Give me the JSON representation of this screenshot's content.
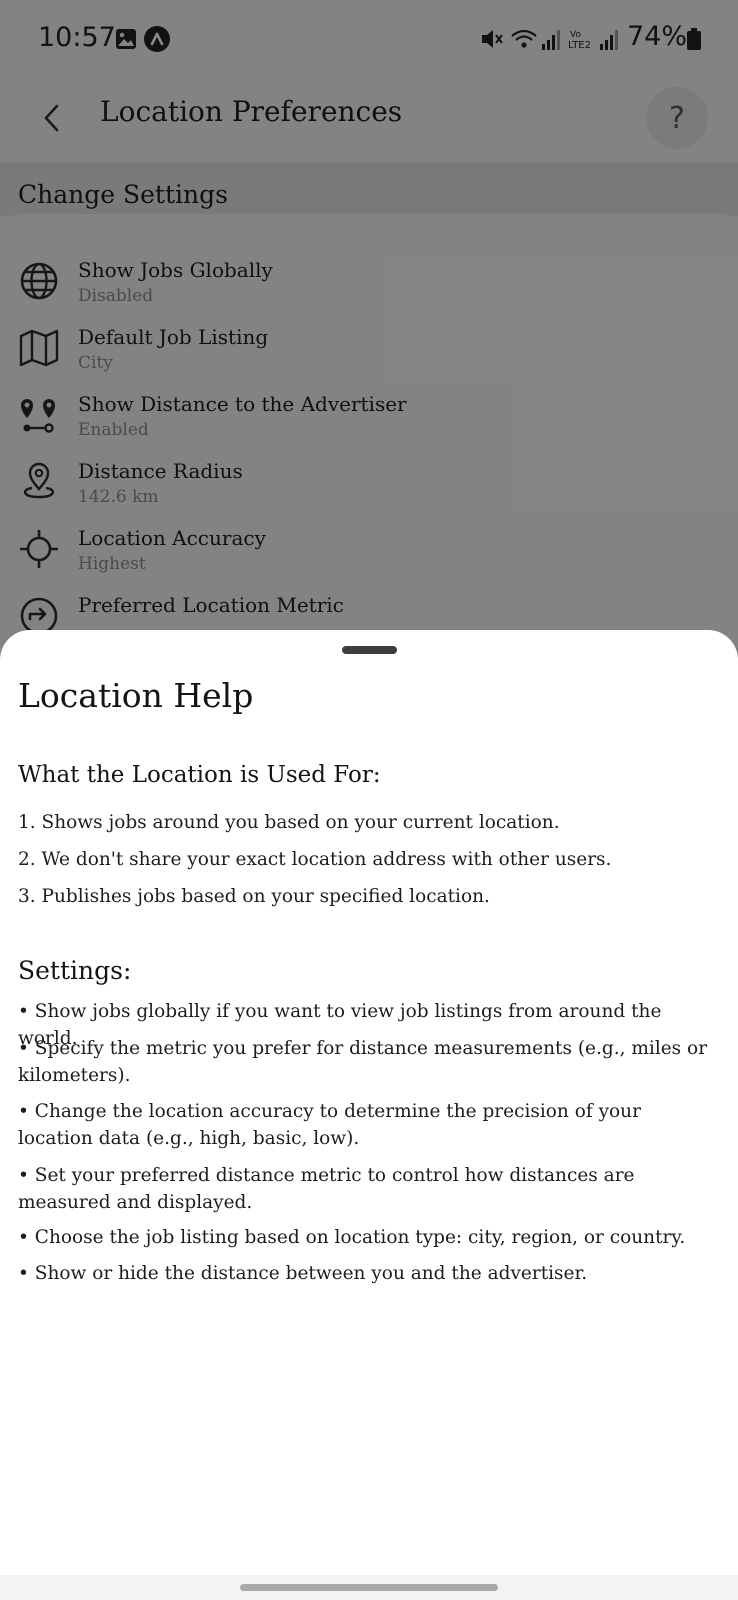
{
  "status_bar": {
    "time": "10:57",
    "battery": "74%",
    "icons": [
      "gallery-icon",
      "app-notification-icon",
      "mute-icon",
      "wifi-icon",
      "signal-icon",
      "volte-icon",
      "battery-icon"
    ]
  },
  "header": {
    "title": "Location Preferences",
    "help_label": "?"
  },
  "section": {
    "title": "Change Settings"
  },
  "settings": [
    {
      "title": "Show Jobs Globally",
      "value": "Disabled",
      "icon": "globe-icon"
    },
    {
      "title": "Default Job Listing",
      "value": "City",
      "icon": "map-icon"
    },
    {
      "title": "Show Distance to the Advertiser",
      "value": "Enabled",
      "icon": "route-icon"
    },
    {
      "title": "Distance Radius",
      "value": "142.6 km",
      "icon": "location-pin-icon"
    },
    {
      "title": "Location Accuracy",
      "value": "Highest",
      "icon": "crosshair-icon"
    },
    {
      "title": "Preferred Location Metric",
      "value": "",
      "icon": "directions-icon"
    }
  ],
  "help_sheet": {
    "title": "Location Help",
    "used_for_heading": "What the Location is Used For:",
    "used_for_items": [
      "1. Shows jobs around you based on your current location.",
      "2. We don't share your exact location address with other users.",
      "3. Publishes jobs based on your specified location."
    ],
    "settings_heading": "Settings:",
    "settings_items": [
      "• Show jobs globally if you want to view job listings from around the world.",
      "• Specify the metric you prefer for distance measurements (e.g., miles or kilometers).",
      "• Change the location accuracy to determine the precision of your location data (e.g., high, basic, low).",
      "• Set your preferred distance metric to control how distances are measured and displayed.",
      "• Choose the job listing based on location type: city, region, or country.",
      "• Show or hide the distance between you and the advertiser."
    ]
  },
  "colors": {
    "scrim": "#000000",
    "sheet_bg": "#ffffff",
    "subtitle_gray": "#8a8a8a"
  }
}
